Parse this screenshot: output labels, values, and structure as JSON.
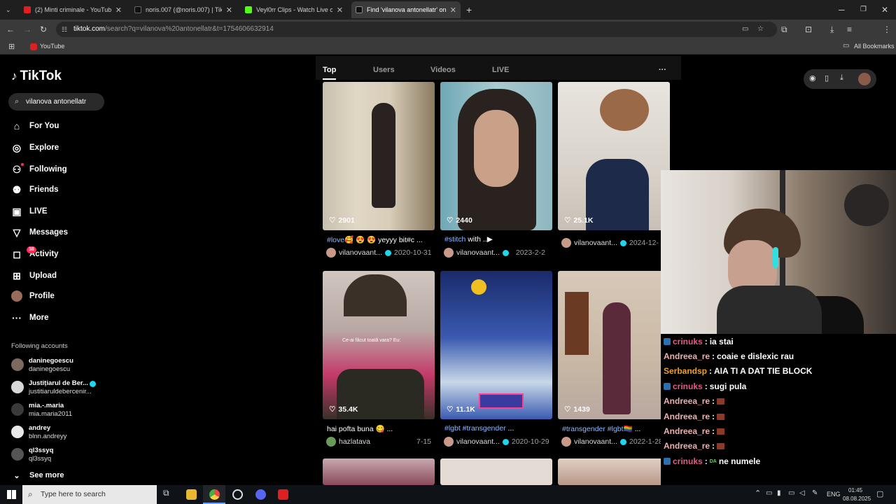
{
  "browser": {
    "tabs": [
      {
        "title": "(2) Minti criminale - YouTube",
        "active": false
      },
      {
        "title": "noris.007 (@noris.007) | TikTok",
        "active": false
      },
      {
        "title": "Veyl0rr Clips - Watch Live on K",
        "active": false
      },
      {
        "title": "Find 'vilanova antonellatr' on Ti",
        "active": true
      }
    ],
    "new_tab": "+",
    "url_host": "tiktok.com",
    "url_path": "/search?q=vilanova%20antonellatr&t=1754606632914",
    "bookmark": "YouTube",
    "all_bookmarks": "All Bookmarks"
  },
  "sidebar": {
    "logo": "TikTok",
    "search_value": "vilanova antonellatr",
    "nav": [
      {
        "label": "For You",
        "icon": "home-icon"
      },
      {
        "label": "Explore",
        "icon": "compass-icon"
      },
      {
        "label": "Following",
        "icon": "user-follow-icon"
      },
      {
        "label": "Friends",
        "icon": "friends-icon"
      },
      {
        "label": "LIVE",
        "icon": "live-icon"
      },
      {
        "label": "Messages",
        "icon": "messages-icon"
      },
      {
        "label": "Activity",
        "icon": "activity-icon",
        "badge": "38"
      },
      {
        "label": "Upload",
        "icon": "upload-icon"
      },
      {
        "label": "Profile",
        "icon": "profile-avatar"
      },
      {
        "label": "More",
        "icon": "more-icon"
      }
    ],
    "following_heading": "Following accounts",
    "accounts": [
      {
        "name": "daninegoescu",
        "handle": "daninegoescu"
      },
      {
        "name": "Justițiarul de Ber...",
        "handle": "justitiaruldebercenir..."
      },
      {
        "name": "mia.-.maria",
        "handle": "mia.maria2011"
      },
      {
        "name": "andrey",
        "handle": "blnn.andreyy"
      },
      {
        "name": "ql3ssyq",
        "handle": "ql3ssyq"
      }
    ],
    "see_more": "See more"
  },
  "search_tabs": [
    "Top",
    "Users",
    "Videos",
    "LIVE"
  ],
  "more_dots": "···",
  "videos": [
    {
      "likes": "2901",
      "caption_tag": "#love",
      "caption": "🥰 😍 😍 yeyyy bit#c ...",
      "author": "vilanovaant...",
      "date": "2020-10-31",
      "verified": true
    },
    {
      "likes": "2440",
      "caption_tag": "#stitch",
      "caption": " with ..▶",
      "author": "vilanovaant...",
      "date": "2023-2-2",
      "verified": true
    },
    {
      "likes": "25.1K",
      "caption_tag": "",
      "caption": "",
      "author": "vilanovaant...",
      "date": "2024-12-",
      "verified": true
    },
    {
      "likes": "35.4K",
      "caption_tag": "",
      "caption": "hai pofta buna 😋 ...",
      "author": "hazlatava",
      "date": "7-15",
      "verified": false
    },
    {
      "likes": "11.1K",
      "caption_tag": "#lgbt #transgender",
      "caption": " ...",
      "author": "vilanovaant...",
      "date": "2020-10-29",
      "verified": true
    },
    {
      "likes": "1439",
      "caption_tag": "#transgender #lgbt",
      "caption": "🏳️‍🌈 ...",
      "author": "vilanovaant...",
      "date": "2022-1-28",
      "verified": true
    }
  ],
  "overlay_text": "Ce-ai făcut toată vara? Eu:",
  "chat": [
    {
      "user": "crinuks",
      "color": "#e05a8a",
      "badge": true,
      "text": "ia stai"
    },
    {
      "user": "Andreea_re",
      "color": "#f0b0b0",
      "badge": false,
      "text": "coaie e dislexic rau"
    },
    {
      "user": "Serbandsp",
      "color": "#f0a020",
      "badge": false,
      "text": "AIA TI A DAT TIE BLOCK"
    },
    {
      "user": "crinuks",
      "color": "#e05a8a",
      "badge": true,
      "text": "sugi pula"
    },
    {
      "user": "Andreea_re",
      "color": "#f0b0b0",
      "badge": false,
      "text": "",
      "emote": true
    },
    {
      "user": "Andreea_re",
      "color": "#f0b0b0",
      "badge": false,
      "text": "",
      "emote": true
    },
    {
      "user": "Andreea_re",
      "color": "#f0b0b0",
      "badge": false,
      "text": "",
      "emote": true
    },
    {
      "user": "Andreea_re",
      "color": "#f0b0b0",
      "badge": false,
      "text": "",
      "emote": true
    },
    {
      "user": "crinuks",
      "color": "#e05a8a",
      "badge": true,
      "text": "ne numele",
      "prefix": "DA"
    }
  ],
  "taskbar": {
    "search_placeholder": "Type here to search",
    "lang": "ENG",
    "time": "01:45",
    "date": "08.08.2025"
  },
  "colors": {
    "accent": "#fe2c55",
    "verified": "#20d5ec",
    "link": "#8fb8ff"
  }
}
